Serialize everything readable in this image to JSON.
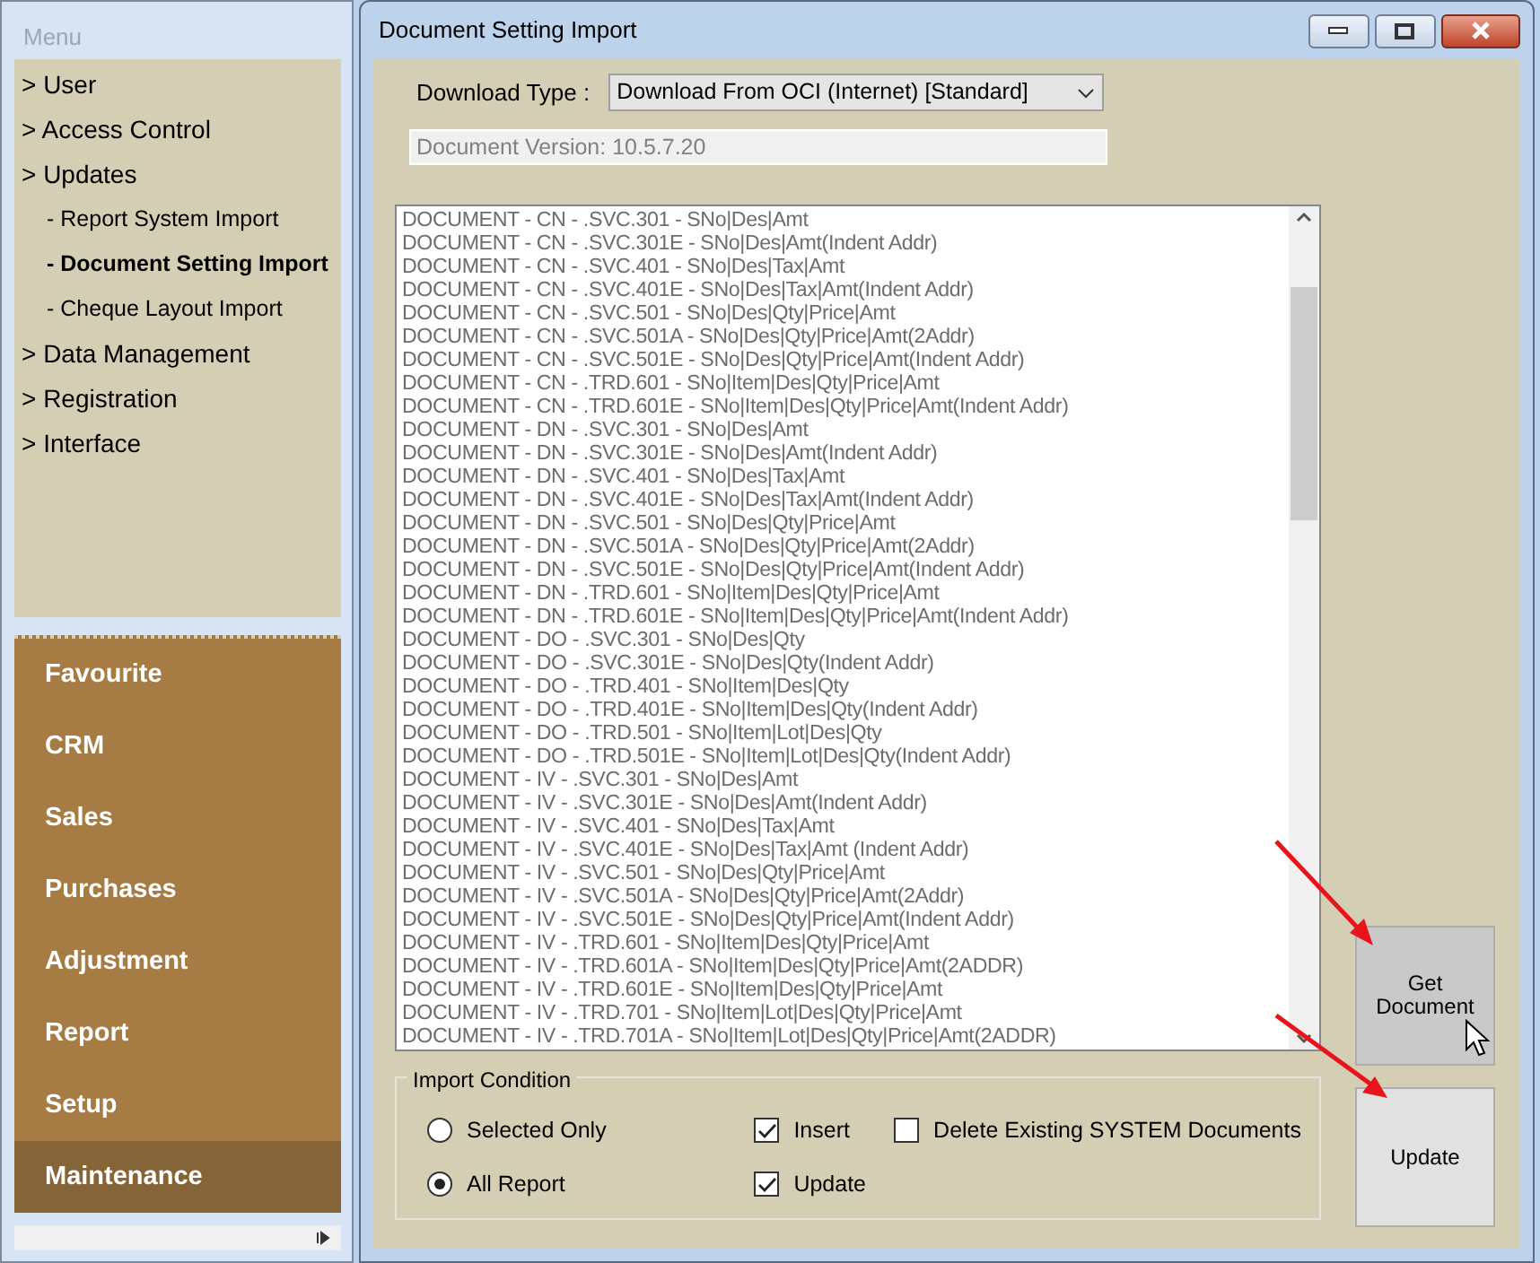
{
  "sidebar": {
    "title": "Menu",
    "tree": [
      {
        "label": "> User"
      },
      {
        "label": "> Access Control"
      },
      {
        "label": "> Updates",
        "children": [
          {
            "label": "- Report System Import",
            "selected": false
          },
          {
            "label": "- Document Setting Import",
            "selected": true
          },
          {
            "label": "- Cheque Layout Import",
            "selected": false
          }
        ]
      },
      {
        "label": "> Data Management"
      },
      {
        "label": "> Registration"
      },
      {
        "label": "> Interface"
      }
    ],
    "modules": [
      {
        "label": "Favourite",
        "selected": false
      },
      {
        "label": "CRM",
        "selected": false
      },
      {
        "label": "Sales",
        "selected": false
      },
      {
        "label": "Purchases",
        "selected": false
      },
      {
        "label": "Adjustment",
        "selected": false
      },
      {
        "label": "Report",
        "selected": false
      },
      {
        "label": "Setup",
        "selected": false
      },
      {
        "label": "Maintenance",
        "selected": true
      }
    ]
  },
  "window": {
    "title": "Document Setting Import",
    "download_type": {
      "label": "Download Type :",
      "value": "Download From OCI (Internet) [Standard]"
    },
    "document_version": {
      "value": "Document Version: 10.5.7.20",
      "disabled": true
    },
    "documents": [
      "DOCUMENT - CN - .SVC.301 - SNo|Des|Amt",
      "DOCUMENT - CN - .SVC.301E - SNo|Des|Amt(Indent Addr)",
      "DOCUMENT - CN - .SVC.401 - SNo|Des|Tax|Amt",
      "DOCUMENT - CN - .SVC.401E - SNo|Des|Tax|Amt(Indent Addr)",
      "DOCUMENT - CN - .SVC.501 - SNo|Des|Qty|Price|Amt",
      "DOCUMENT - CN - .SVC.501A - SNo|Des|Qty|Price|Amt(2Addr)",
      "DOCUMENT - CN - .SVC.501E - SNo|Des|Qty|Price|Amt(Indent Addr)",
      "DOCUMENT - CN - .TRD.601 - SNo|Item|Des|Qty|Price|Amt",
      "DOCUMENT - CN - .TRD.601E - SNo|Item|Des|Qty|Price|Amt(Indent Addr)",
      "DOCUMENT - DN - .SVC.301 - SNo|Des|Amt",
      "DOCUMENT - DN - .SVC.301E - SNo|Des|Amt(Indent Addr)",
      "DOCUMENT - DN - .SVC.401 - SNo|Des|Tax|Amt",
      "DOCUMENT - DN - .SVC.401E - SNo|Des|Tax|Amt(Indent Addr)",
      "DOCUMENT - DN - .SVC.501 - SNo|Des|Qty|Price|Amt",
      "DOCUMENT - DN - .SVC.501A - SNo|Des|Qty|Price|Amt(2Addr)",
      "DOCUMENT - DN - .SVC.501E - SNo|Des|Qty|Price|Amt(Indent Addr)",
      "DOCUMENT - DN - .TRD.601 - SNo|Item|Des|Qty|Price|Amt",
      "DOCUMENT - DN - .TRD.601E - SNo|Item|Des|Qty|Price|Amt(Indent Addr)",
      "DOCUMENT - DO - .SVC.301 - SNo|Des|Qty",
      "DOCUMENT - DO - .SVC.301E - SNo|Des|Qty(Indent Addr)",
      "DOCUMENT - DO - .TRD.401 - SNo|Item|Des|Qty",
      "DOCUMENT - DO - .TRD.401E - SNo|Item|Des|Qty(Indent Addr)",
      "DOCUMENT - DO - .TRD.501 - SNo|Item|Lot|Des|Qty",
      "DOCUMENT - DO - .TRD.501E - SNo|Item|Lot|Des|Qty(Indent Addr)",
      "DOCUMENT - IV - .SVC.301 - SNo|Des|Amt",
      "DOCUMENT - IV - .SVC.301E - SNo|Des|Amt(Indent Addr)",
      "DOCUMENT - IV - .SVC.401 - SNo|Des|Tax|Amt",
      "DOCUMENT - IV - .SVC.401E - SNo|Des|Tax|Amt (Indent Addr)",
      "DOCUMENT - IV - .SVC.501 - SNo|Des|Qty|Price|Amt",
      "DOCUMENT - IV - .SVC.501A - SNo|Des|Qty|Price|Amt(2Addr)",
      "DOCUMENT - IV - .SVC.501E - SNo|Des|Qty|Price|Amt(Indent Addr)",
      "DOCUMENT - IV - .TRD.601 - SNo|Item|Des|Qty|Price|Amt",
      "DOCUMENT - IV - .TRD.601A - SNo|Item|Des|Qty|Price|Amt(2ADDR)",
      "DOCUMENT - IV - .TRD.601E - SNo|Item|Des|Qty|Price|Amt",
      "DOCUMENT - IV - .TRD.701 - SNo|Item|Lot|Des|Qty|Price|Amt",
      "DOCUMENT - IV - .TRD.701A - SNo|Item|Lot|Des|Qty|Price|Amt(2ADDR)"
    ],
    "import_condition": {
      "title": "Import Condition",
      "radios": [
        {
          "label": "Selected Only",
          "selected": false
        },
        {
          "label": "All Report",
          "selected": true
        }
      ],
      "checkboxes": [
        {
          "label": "Insert",
          "checked": true
        },
        {
          "label": "Update",
          "checked": true
        },
        {
          "label": "Delete Existing SYSTEM Documents",
          "checked": false
        }
      ]
    },
    "buttons": [
      {
        "label": "Get Document",
        "hovered": true
      },
      {
        "label": "Update",
        "hovered": false
      }
    ]
  }
}
